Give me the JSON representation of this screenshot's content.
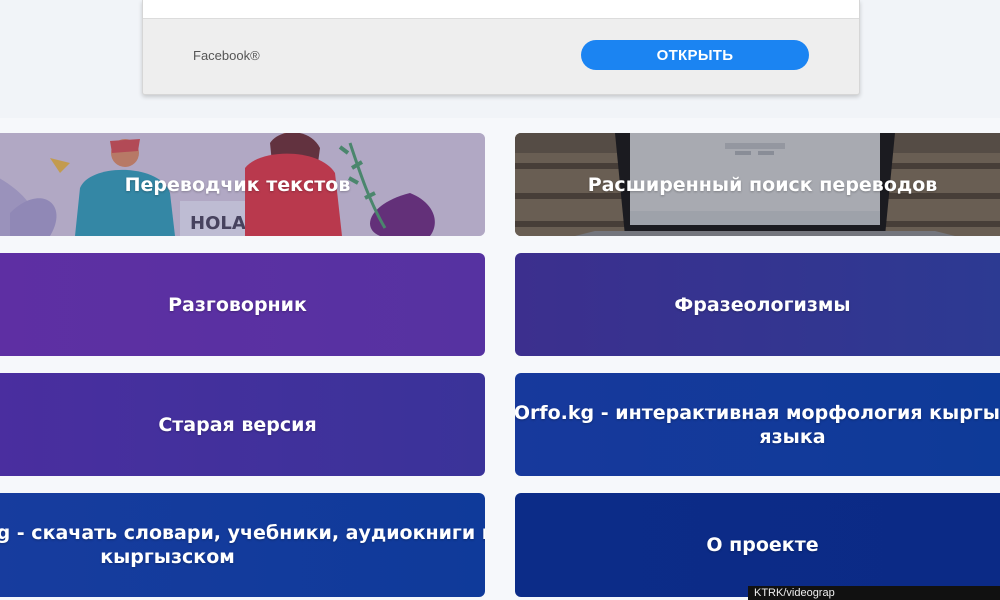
{
  "ad": {
    "brand": "Facebook®",
    "open_label": "ОТКРЫТЬ"
  },
  "tiles": [
    {
      "label": "Переводчик текстов",
      "illustration_text": "HOLA",
      "background": "illustration"
    },
    {
      "label": "Расширенный поиск переводов",
      "background": "laptop-photo"
    },
    {
      "label": "Разговорник",
      "color": "#5a2e9e"
    },
    {
      "label": "Фразеологизмы",
      "color": "#3a2f8c"
    },
    {
      "label": "Старая версия",
      "color": "#432f9c"
    },
    {
      "label_line1": "Orfo.kg - интерактивная морфология кыргызского",
      "label_line2": "языка",
      "color": "#12379a"
    },
    {
      "label_line1": "Kitepkana.din.kg - скачать словари, учебники, аудиокниги на",
      "label_line2": "кыргызском",
      "color": "#103a9a"
    },
    {
      "label": "О проекте",
      "color": "#0d2d8a"
    }
  ],
  "watermark": "KTRK/videograp"
}
